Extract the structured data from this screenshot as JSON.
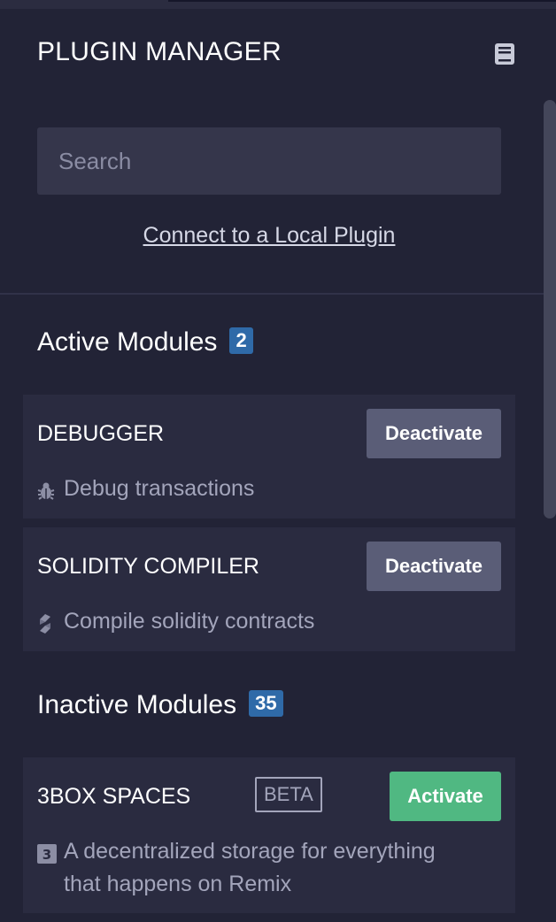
{
  "header": {
    "title": "PLUGIN MANAGER",
    "docs_icon": "book-icon"
  },
  "search": {
    "placeholder": "Search",
    "value": ""
  },
  "connect_link": "Connect to a Local Plugin",
  "active": {
    "heading": "Active Modules",
    "count": "2",
    "modules": [
      {
        "name": "DEBUGGER",
        "button": "Deactivate",
        "icon": "bug-icon",
        "description": "Debug transactions"
      },
      {
        "name": "SOLIDITY COMPILER",
        "button": "Deactivate",
        "icon": "solidity-icon",
        "description": "Compile solidity contracts"
      }
    ]
  },
  "inactive": {
    "heading": "Inactive Modules",
    "count": "35",
    "modules": [
      {
        "name": "3BOX SPACES",
        "tag": "BETA",
        "button": "Activate",
        "icon": "3box-icon",
        "description_line1": "A decentralized storage for everything",
        "description_line2": "that happens on Remix"
      }
    ]
  },
  "colors": {
    "background": "#222336",
    "card": "#2a2b40",
    "badge": "#2f6aa8",
    "deactivate": "#5a5d77",
    "activate": "#50b882"
  }
}
